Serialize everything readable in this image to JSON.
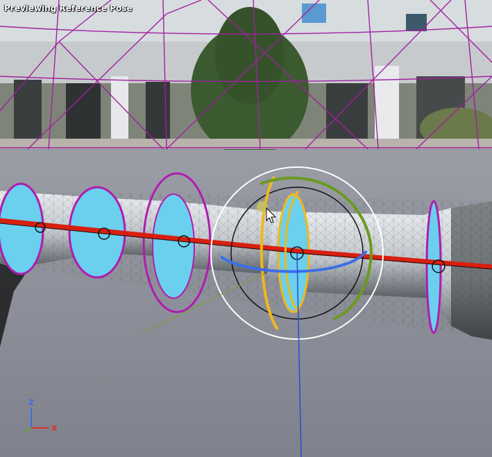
{
  "viewport": {
    "mode_label": "Previewing Reference Pose"
  },
  "axis_indicator": {
    "z_label": "Z",
    "x_label": "X",
    "colors": {
      "z": "#3a6ee8",
      "x": "#e0302a",
      "y": "#5fb030"
    }
  },
  "colors": {
    "floor_grid": "#a020a0",
    "bone_line": "#d81f10",
    "collision_shape": "#6ad0ee",
    "collision_outline": "#b01cb0",
    "gizmo_yellow": "#f0b81c",
    "gizmo_green": "#6a9a1c",
    "gizmo_blue": "#3a6ee8",
    "gizmo_white": "#ffffff"
  }
}
